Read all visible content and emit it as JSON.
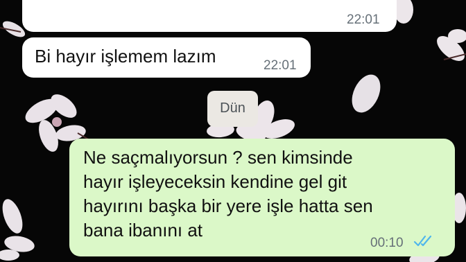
{
  "chat": {
    "messages": [
      {
        "direction": "incoming",
        "text": "",
        "time": "22:01"
      },
      {
        "direction": "incoming",
        "text": "Bi hayır işlemem lazım",
        "time": "22:01"
      },
      {
        "direction": "outgoing",
        "lines": [
          "Ne saçmalıyorsun ? sen kimsinde",
          "hayır işleyeceksin kendine gel git",
          "hayırını başka bir yere işle hatta sen",
          "bana ibanını at"
        ],
        "time": "00:10",
        "status_icon": "double-check-read-icon"
      }
    ],
    "date_separator": "Dün"
  },
  "colors": {
    "background": "#060606",
    "incoming_bubble": "#ffffff",
    "outgoing_bubble": "#dbf8c8",
    "read_ticks": "#4fb6ec",
    "timestamp": "#667078"
  },
  "icons": {
    "wallpaper": "cherry-blossom-wallpaper-icon",
    "read_receipt": "double-check-read-icon"
  }
}
